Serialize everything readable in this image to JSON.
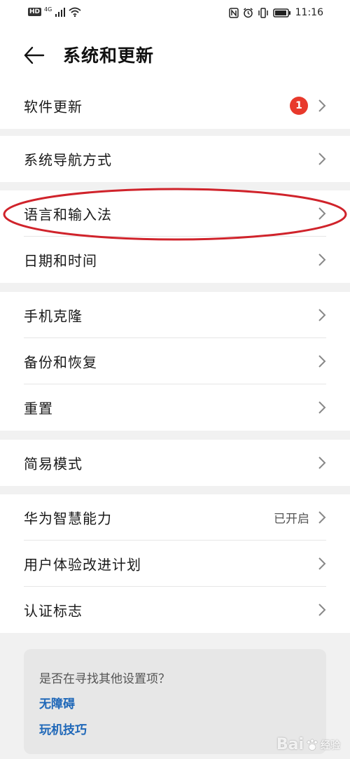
{
  "status_bar": {
    "hd": "HD",
    "network": "4G",
    "time": "11:16"
  },
  "header": {
    "title": "系统和更新"
  },
  "groups": [
    {
      "items": [
        {
          "label": "软件更新",
          "badge": "1"
        }
      ]
    },
    {
      "items": [
        {
          "label": "系统导航方式"
        }
      ]
    },
    {
      "items": [
        {
          "label": "语言和输入法"
        },
        {
          "label": "日期和时间"
        }
      ]
    },
    {
      "items": [
        {
          "label": "手机克隆"
        },
        {
          "label": "备份和恢复"
        },
        {
          "label": "重置"
        }
      ]
    },
    {
      "items": [
        {
          "label": "简易模式"
        }
      ]
    },
    {
      "items": [
        {
          "label": "华为智慧能力",
          "status": "已开启"
        },
        {
          "label": "用户体验改进计划"
        },
        {
          "label": "认证标志"
        }
      ]
    }
  ],
  "suggestions": {
    "question": "是否在寻找其他设置项？",
    "links": [
      "无障碍",
      "玩机技巧"
    ]
  },
  "watermark": {
    "brand": "Bai",
    "suffix": "经验"
  },
  "colors": {
    "accent_link": "#1e67b8",
    "badge": "#e8392c",
    "annotation": "#d0232b"
  }
}
